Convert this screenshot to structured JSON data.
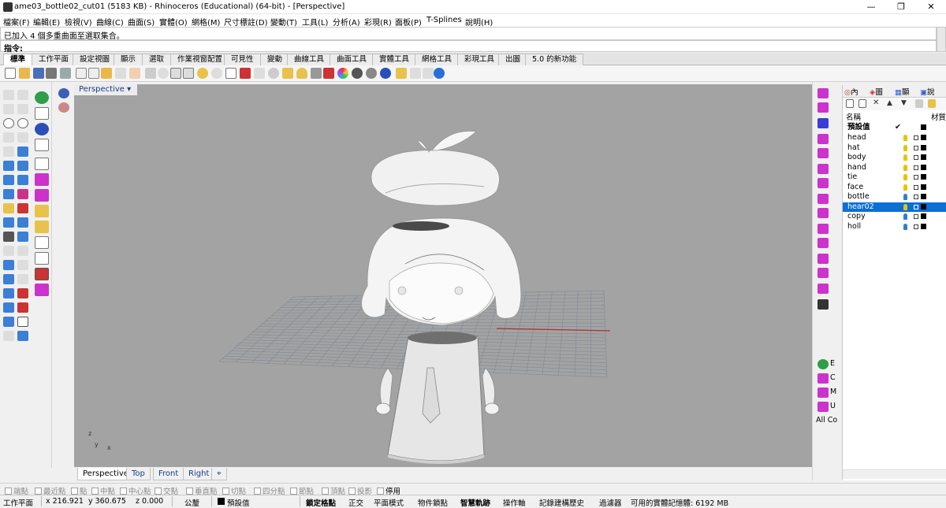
{
  "window": {
    "title": "ame03_bottle02_cut01 (5183 KB) - Rhinoceros (Educational) (64-bit) - [Perspective]",
    "min_glyph": "—",
    "max_glyph": "❐",
    "close_glyph": "✕"
  },
  "menu": [
    "檔案(F)",
    "編輯(E)",
    "檢視(V)",
    "曲線(C)",
    "曲面(S)",
    "實體(O)",
    "網格(M)",
    "尺寸標註(D)",
    "變動(T)",
    "工具(L)",
    "分析(A)",
    "彩現(R)",
    "面板(P)",
    "T-Splines",
    "說明(H)"
  ],
  "command": {
    "history": "已加入 4 個多重曲面至選取集合。",
    "prompt": "指令:"
  },
  "toolbar_tabs": [
    "標準",
    "工作平面",
    "設定視圖",
    "顯示",
    "選取",
    "作業視窗配置",
    "可見性",
    "變動",
    "曲線工具",
    "曲面工具",
    "實體工具",
    "網格工具",
    "彩現工具",
    "出圖",
    "5.0 的新功能"
  ],
  "viewport": {
    "title": "Perspective",
    "axis_z": "z",
    "axis_y": "y",
    "axis_x": "x"
  },
  "viewport_tabs": [
    "Perspective",
    "Top",
    "Front",
    "Right",
    "⌖"
  ],
  "right_tools": {
    "e": "E",
    "c": "C",
    "m": "M",
    "u": "U",
    "allco": "All Co"
  },
  "panel": {
    "tabs": [
      "內",
      "圖",
      "顯",
      "說"
    ],
    "col_name": "名稱",
    "col_mat": "材質",
    "default_layer": "預設值",
    "default_check": "✔",
    "layers": [
      {
        "name": "head",
        "selected": false,
        "bulb": "#e8c400"
      },
      {
        "name": "hat",
        "selected": false,
        "bulb": "#e8c400"
      },
      {
        "name": "body",
        "selected": false,
        "bulb": "#e8c400"
      },
      {
        "name": "hand",
        "selected": false,
        "bulb": "#e8c400"
      },
      {
        "name": "tie",
        "selected": false,
        "bulb": "#e8c400"
      },
      {
        "name": "face",
        "selected": false,
        "bulb": "#e8c400"
      },
      {
        "name": "bottle",
        "selected": false,
        "bulb": "#2f7fd6"
      },
      {
        "name": "hear02",
        "selected": true,
        "bulb": "#e8c400"
      },
      {
        "name": "copy",
        "selected": false,
        "bulb": "#2f7fd6"
      },
      {
        "name": "holl",
        "selected": false,
        "bulb": "#2f7fd6"
      }
    ]
  },
  "osnap": [
    "端點",
    "最近點",
    "點",
    "中點",
    "中心點",
    "交點",
    "垂直點",
    "切點",
    "四分點",
    "節點",
    "頂點",
    "投影",
    "停用"
  ],
  "status": {
    "cplane": "工作平面",
    "x": "x 216.921",
    "y": "y 360.675",
    "z": "z 0.000",
    "units": "公釐",
    "layer": "預設值",
    "grid_snap": "鎖定格點",
    "ortho": "正交",
    "planar": "平面模式",
    "osnap": "物件鎖點",
    "smarttrack": "智慧軌跡",
    "gumball": "操作軸",
    "history": "記錄建構歷史",
    "filter": "過濾器",
    "memory": "可用的實體記憶體: 6192 MB"
  },
  "colors": {
    "viewport_bg": "#a3a3a3",
    "grid_line": "#7f8a97",
    "grid_x_axis": "#b03030",
    "selection": "#0b6fd6"
  }
}
